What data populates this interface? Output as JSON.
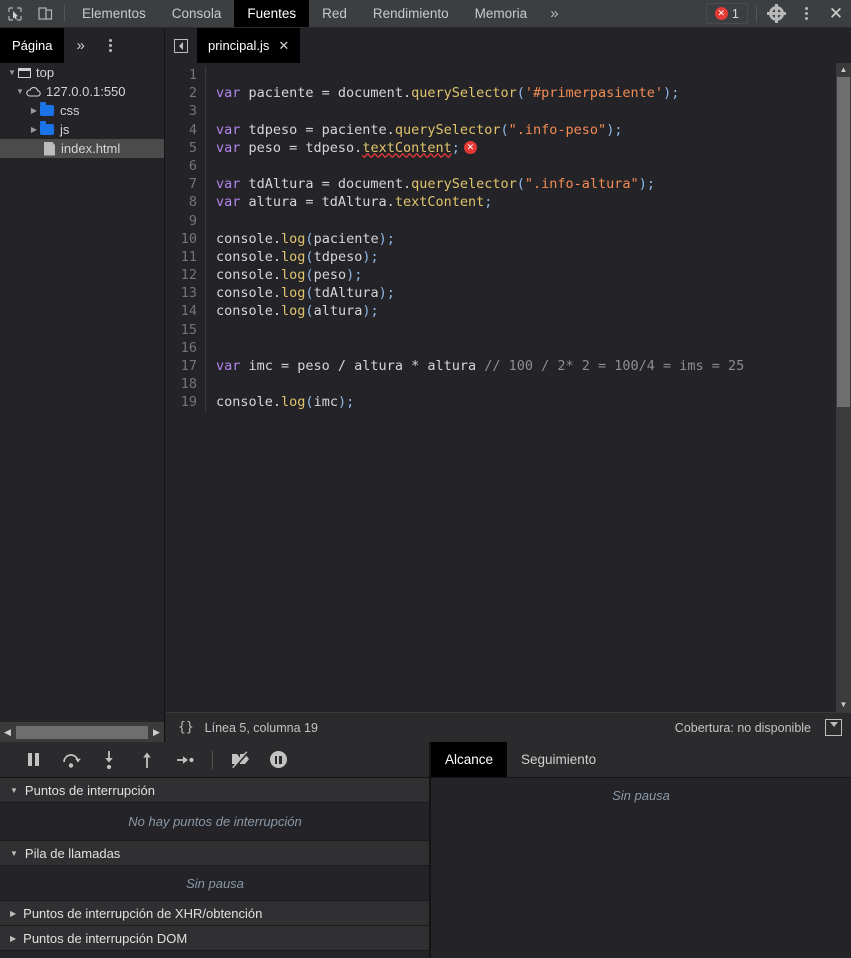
{
  "toolbar": {
    "icons": [
      {
        "name": "inspect-element-icon",
        "glyph": "↖"
      },
      {
        "name": "device-toolbar-icon",
        "glyph": "▭"
      }
    ],
    "tabs": [
      {
        "label": "Elementos",
        "selected": false
      },
      {
        "label": "Consola",
        "selected": false
      },
      {
        "label": "Fuentes",
        "selected": true
      },
      {
        "label": "Red",
        "selected": false
      },
      {
        "label": "Rendimiento",
        "selected": false
      },
      {
        "label": "Memoria",
        "selected": false
      }
    ],
    "more_tabs_glyph": "»",
    "error_count": "1",
    "error_dot_glyph": "✕",
    "settings_icon": "gear-icon",
    "menu_icon": "kebab-menu-icon",
    "close_icon": "close-icon",
    "close_glyph": "✕",
    "accent_error": "#e53935"
  },
  "subtoolbar": {
    "nav_tabs": [
      {
        "label": "Página",
        "selected": true
      }
    ],
    "more_glyph": "»",
    "menu_icon": "kebab-menu-icon",
    "collapse_icon": "collapse-sidebar-icon",
    "file_tab": {
      "label": "principal.js",
      "close_glyph": "✕"
    }
  },
  "navigator": {
    "tree": [
      {
        "label": "top",
        "icon": "frame-icon",
        "arrow": "▼",
        "indent": 0,
        "selected": false
      },
      {
        "label": "127.0.0.1:550",
        "icon": "cloud-icon",
        "arrow": "▼",
        "indent": 1,
        "selected": false
      },
      {
        "label": "css",
        "icon": "folder-icon",
        "arrow": "▶",
        "indent": 2,
        "selected": false
      },
      {
        "label": "js",
        "icon": "folder-icon",
        "arrow": "▶",
        "indent": 2,
        "selected": false
      },
      {
        "label": "index.html",
        "icon": "file-icon",
        "arrow": "",
        "indent": 3,
        "selected": true
      }
    ],
    "hscroll_left_glyph": "◀",
    "hscroll_right_glyph": "▶"
  },
  "editor": {
    "lines": [
      {
        "n": "1",
        "tokens": []
      },
      {
        "n": "2",
        "tokens": [
          {
            "t": "var ",
            "c": "kw"
          },
          {
            "t": "paciente = document.",
            "c": "ctext"
          },
          {
            "t": "querySelector",
            "c": "prop"
          },
          {
            "t": "(",
            "c": "punct"
          },
          {
            "t": "'#primerpasiente'",
            "c": "str"
          },
          {
            "t": ")",
            "c": "punct"
          },
          {
            "t": ";",
            "c": "punct"
          }
        ]
      },
      {
        "n": "3",
        "tokens": []
      },
      {
        "n": "4",
        "tokens": [
          {
            "t": "var ",
            "c": "kw"
          },
          {
            "t": "tdpeso = paciente.",
            "c": "ctext"
          },
          {
            "t": "querySelector",
            "c": "prop"
          },
          {
            "t": "(",
            "c": "punct"
          },
          {
            "t": "\".info-peso\"",
            "c": "str"
          },
          {
            "t": ")",
            "c": "punct"
          },
          {
            "t": ";",
            "c": "punct"
          }
        ]
      },
      {
        "n": "5",
        "tokens": [
          {
            "t": "var ",
            "c": "kw"
          },
          {
            "t": "peso = tdpeso.",
            "c": "ctext"
          },
          {
            "t": "textContent",
            "c": "prop err-underline"
          },
          {
            "t": ";",
            "c": "punct"
          }
        ],
        "error": true
      },
      {
        "n": "6",
        "tokens": []
      },
      {
        "n": "7",
        "tokens": [
          {
            "t": "var ",
            "c": "kw"
          },
          {
            "t": "tdAltura = document.",
            "c": "ctext"
          },
          {
            "t": "querySelector",
            "c": "prop"
          },
          {
            "t": "(",
            "c": "punct"
          },
          {
            "t": "\".info-altura\"",
            "c": "str"
          },
          {
            "t": ")",
            "c": "punct"
          },
          {
            "t": ";",
            "c": "punct"
          }
        ]
      },
      {
        "n": "8",
        "tokens": [
          {
            "t": "var ",
            "c": "kw"
          },
          {
            "t": "altura = tdAltura.",
            "c": "ctext"
          },
          {
            "t": "textContent",
            "c": "prop"
          },
          {
            "t": ";",
            "c": "punct"
          }
        ]
      },
      {
        "n": "9",
        "tokens": []
      },
      {
        "n": "10",
        "tokens": [
          {
            "t": "console.",
            "c": "ctext"
          },
          {
            "t": "log",
            "c": "prop"
          },
          {
            "t": "(",
            "c": "punct"
          },
          {
            "t": "paciente",
            "c": "ctext"
          },
          {
            "t": ")",
            "c": "punct"
          },
          {
            "t": ";",
            "c": "punct"
          }
        ]
      },
      {
        "n": "11",
        "tokens": [
          {
            "t": "console.",
            "c": "ctext"
          },
          {
            "t": "log",
            "c": "prop"
          },
          {
            "t": "(",
            "c": "punct"
          },
          {
            "t": "tdpeso",
            "c": "ctext"
          },
          {
            "t": ")",
            "c": "punct"
          },
          {
            "t": ";",
            "c": "punct"
          }
        ]
      },
      {
        "n": "12",
        "tokens": [
          {
            "t": "console.",
            "c": "ctext"
          },
          {
            "t": "log",
            "c": "prop"
          },
          {
            "t": "(",
            "c": "punct"
          },
          {
            "t": "peso",
            "c": "ctext"
          },
          {
            "t": ")",
            "c": "punct"
          },
          {
            "t": ";",
            "c": "punct"
          }
        ]
      },
      {
        "n": "13",
        "tokens": [
          {
            "t": "console.",
            "c": "ctext"
          },
          {
            "t": "log",
            "c": "prop"
          },
          {
            "t": "(",
            "c": "punct"
          },
          {
            "t": "tdAltura",
            "c": "ctext"
          },
          {
            "t": ")",
            "c": "punct"
          },
          {
            "t": ";",
            "c": "punct"
          }
        ]
      },
      {
        "n": "14",
        "tokens": [
          {
            "t": "console.",
            "c": "ctext"
          },
          {
            "t": "log",
            "c": "prop"
          },
          {
            "t": "(",
            "c": "punct"
          },
          {
            "t": "altura",
            "c": "ctext"
          },
          {
            "t": ")",
            "c": "punct"
          },
          {
            "t": ";",
            "c": "punct"
          }
        ]
      },
      {
        "n": "15",
        "tokens": []
      },
      {
        "n": "16",
        "tokens": []
      },
      {
        "n": "17",
        "tokens": [
          {
            "t": "var ",
            "c": "kw"
          },
          {
            "t": "imc = peso / altura * altura ",
            "c": "ctext"
          },
          {
            "t": "// 100 / 2* 2 = 100/4 = ims = 25",
            "c": "cmt"
          }
        ]
      },
      {
        "n": "18",
        "tokens": []
      },
      {
        "n": "19",
        "tokens": [
          {
            "t": "console.",
            "c": "ctext"
          },
          {
            "t": "log",
            "c": "prop"
          },
          {
            "t": "(",
            "c": "punct"
          },
          {
            "t": "imc",
            "c": "ctext"
          },
          {
            "t": ")",
            "c": "punct"
          },
          {
            "t": ";",
            "c": "punct"
          }
        ]
      }
    ],
    "error_bubble_glyph": "✕",
    "scroll_up_glyph": "▲",
    "scroll_down_glyph": "▼"
  },
  "status_bar": {
    "format_icon_label": "{}",
    "position": "Línea 5, columna 19",
    "coverage": "Cobertura: no disponible",
    "drawer_icon": "show-drawer-icon"
  },
  "debugger": {
    "buttons": [
      {
        "name": "resume-button",
        "icon": "pause-icon"
      },
      {
        "name": "step-over-button",
        "icon": "step-over-icon",
        "glyph": "⤷"
      },
      {
        "name": "step-into-button",
        "icon": "step-into-icon",
        "glyph": "↓"
      },
      {
        "name": "step-out-button",
        "icon": "step-out-icon",
        "glyph": "↑"
      },
      {
        "name": "step-button",
        "icon": "step-icon",
        "glyph": "→"
      },
      {
        "name": "deactivate-breakpoints-button",
        "icon": "deactivate-breakpoints-icon",
        "glyph": "⧸"
      },
      {
        "name": "pause-on-exceptions-button",
        "icon": "pause-circle-icon"
      }
    ]
  },
  "breakpoints_panel": {
    "sections": [
      {
        "title": "Puntos de interrupción",
        "arrow": "▼",
        "body": "No hay puntos de interrupción"
      },
      {
        "title": "Pila de llamadas",
        "arrow": "▼",
        "body": "Sin pausa"
      },
      {
        "title": "Puntos de interrupción de XHR/obtención",
        "arrow": "▶",
        "body": null
      },
      {
        "title": "Puntos de interrupción DOM",
        "arrow": "▶",
        "body": null
      }
    ],
    "scroll_up_glyph": "▲",
    "scroll_down_glyph": "▼"
  },
  "scope_panel": {
    "tabs": [
      {
        "label": "Alcance",
        "selected": true
      },
      {
        "label": "Seguimiento",
        "selected": false
      }
    ],
    "body": "Sin pausa"
  }
}
